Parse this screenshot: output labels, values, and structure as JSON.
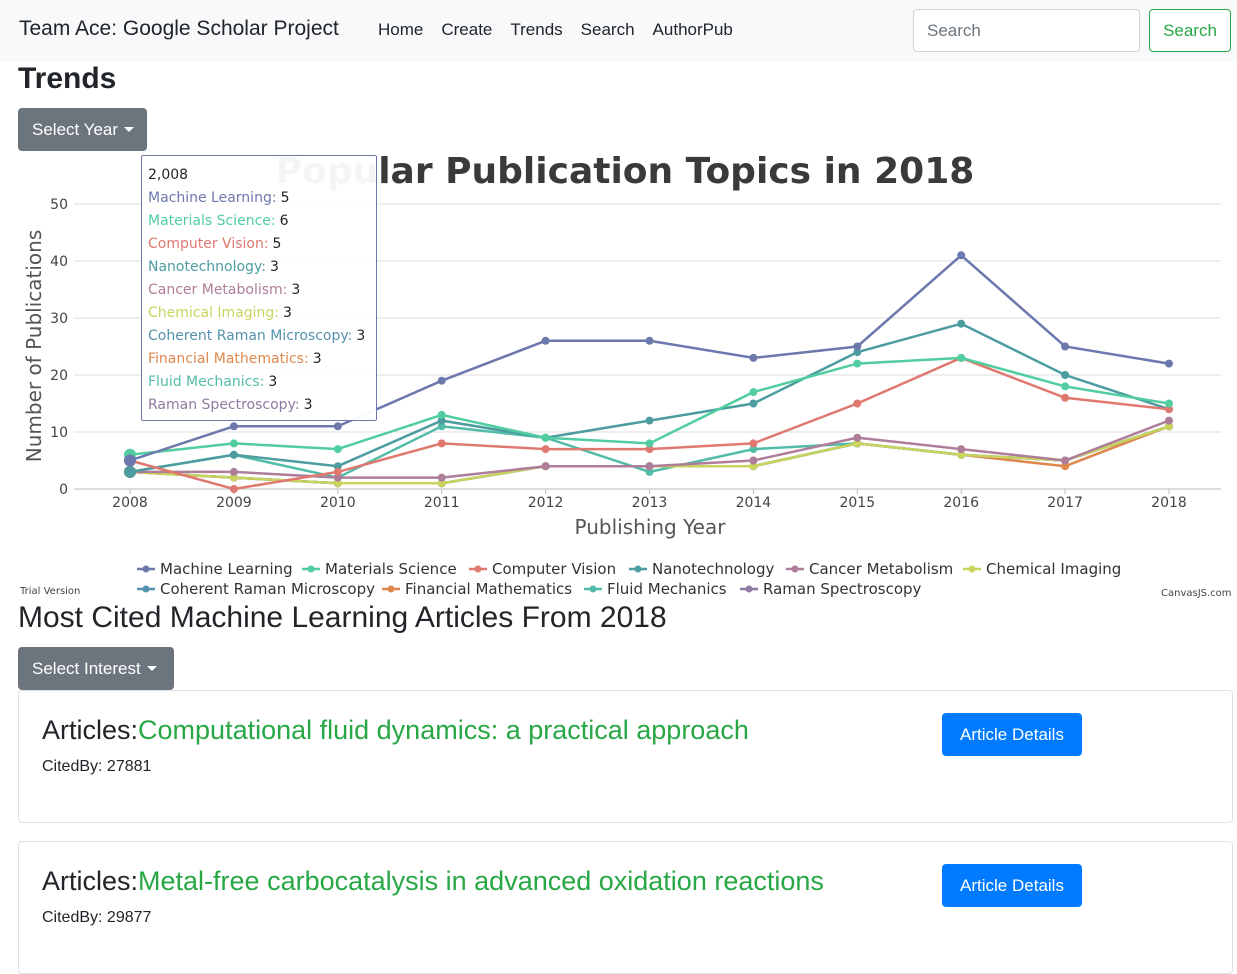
{
  "navbar": {
    "brand": "Team Ace: Google Scholar Project",
    "links": [
      "Home",
      "Create",
      "Trends",
      "Search",
      "AuthorPub"
    ],
    "search_placeholder": "Search",
    "search_button": "Search"
  },
  "trends": {
    "heading": "Trends",
    "select_year_label": "Select Year"
  },
  "chart_data": {
    "type": "line",
    "title": "Popular Publication Topics in 2018",
    "xlabel": "Publishing Year",
    "ylabel": "Number of Publications",
    "ylim": [
      0,
      50
    ],
    "yticks": [
      0,
      10,
      20,
      30,
      40,
      50
    ],
    "x": [
      2008,
      2009,
      2010,
      2011,
      2012,
      2013,
      2014,
      2015,
      2016,
      2017,
      2018
    ],
    "grid": "horizontal",
    "legend_position": "bottom",
    "series": [
      {
        "name": "Machine Learning",
        "color": "#6D78AD",
        "values": [
          5,
          11,
          11,
          19,
          26,
          26,
          23,
          25,
          41,
          25,
          22
        ]
      },
      {
        "name": "Materials Science",
        "color": "#51CDA0",
        "values": [
          6,
          8,
          7,
          13,
          9,
          8,
          17,
          22,
          23,
          18,
          15
        ]
      },
      {
        "name": "Computer Vision",
        "color": "#DF7970",
        "values": [
          5,
          0,
          3,
          8,
          7,
          7,
          8,
          15,
          23,
          16,
          14
        ]
      },
      {
        "name": "Nanotechnology",
        "color": "#4C9CA0",
        "values": [
          3,
          6,
          4,
          12,
          9,
          12,
          15,
          24,
          29,
          20,
          14
        ]
      },
      {
        "name": "Cancer Metabolism",
        "color": "#AE7D99",
        "values": [
          3,
          3,
          2,
          2,
          4,
          4,
          5,
          9,
          7,
          5,
          12
        ]
      },
      {
        "name": "Chemical Imaging",
        "color": "#C9D45C",
        "values": [
          3,
          2,
          1,
          1,
          4,
          4,
          4,
          8,
          6,
          5,
          11
        ]
      },
      {
        "name": "Coherent Raman Microscopy",
        "color": "#5592AD",
        "values": [
          3,
          2,
          1,
          1,
          4,
          4,
          4,
          8,
          6,
          5,
          11
        ]
      },
      {
        "name": "Financial Mathematics",
        "color": "#DF874D",
        "values": [
          3,
          2,
          1,
          1,
          4,
          4,
          4,
          8,
          6,
          4,
          11
        ]
      },
      {
        "name": "Fluid Mechanics",
        "color": "#52BCA8",
        "values": [
          3,
          6,
          2,
          11,
          9,
          3,
          7,
          8,
          6,
          5,
          11
        ]
      },
      {
        "name": "Raman Spectroscopy",
        "color": "#8E7AA3",
        "values": [
          3,
          2,
          1,
          1,
          4,
          4,
          4,
          8,
          6,
          5,
          11
        ]
      }
    ],
    "tooltip": {
      "header": "2,008",
      "rows": [
        {
          "name": "Machine Learning",
          "value": "5"
        },
        {
          "name": "Materials Science",
          "value": "6"
        },
        {
          "name": "Computer Vision",
          "value": "5"
        },
        {
          "name": "Nanotechnology",
          "value": "3"
        },
        {
          "name": "Cancer Metabolism",
          "value": "3"
        },
        {
          "name": "Chemical Imaging",
          "value": "3"
        },
        {
          "name": "Coherent Raman Microscopy",
          "value": "3"
        },
        {
          "name": "Financial Mathematics",
          "value": "3"
        },
        {
          "name": "Fluid Mechanics",
          "value": "3"
        },
        {
          "name": "Raman Spectroscopy",
          "value": "3"
        }
      ]
    },
    "trial_text": "Trial Version",
    "credit_text": "CanvasJS.com"
  },
  "cited": {
    "heading": "Most Cited Machine Learning Articles From 2018",
    "select_interest_label": "Select Interest",
    "articles": [
      {
        "prefix": "Articles:",
        "title": "Computational fluid dynamics: a practical approach",
        "cited": "CitedBy: 27881",
        "button": "Article Details"
      },
      {
        "prefix": "Articles:",
        "title": "Metal-free carbocatalysis in advanced oxidation reactions",
        "cited": "CitedBy: 29877",
        "button": "Article Details"
      }
    ]
  }
}
